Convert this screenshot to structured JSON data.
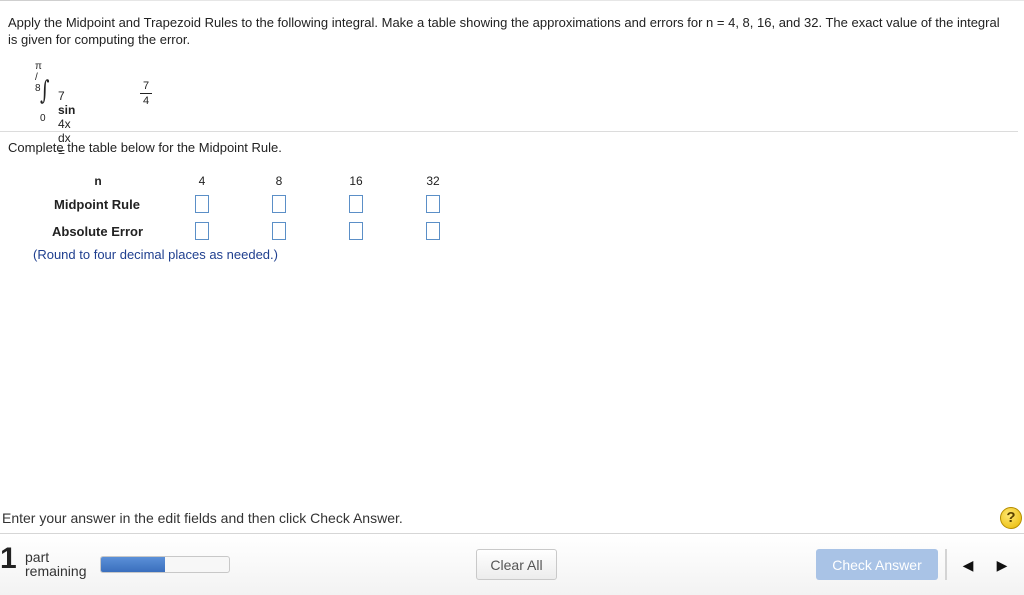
{
  "question": {
    "text": "Apply the Midpoint and Trapezoid Rules to the following integral. Make a table showing the approximations and errors for n = 4, 8, 16, and 32. The exact value of the integral is given for computing the error."
  },
  "integral": {
    "upper_limit": "π / 8",
    "lower_limit": "0",
    "integrand_prefix": "7 ",
    "integrand_sin": "sin",
    "integrand_suffix": " 4x dx =",
    "result_numerator": "7",
    "result_denominator": "4"
  },
  "instruction": "Complete the table below for the Midpoint Rule.",
  "table": {
    "header_label": "n",
    "columns": [
      "4",
      "8",
      "16",
      "32"
    ],
    "rows": [
      {
        "label": "Midpoint Rule",
        "values": [
          "",
          "",
          "",
          ""
        ]
      },
      {
        "label": "Absolute Error",
        "values": [
          "",
          "",
          "",
          ""
        ]
      }
    ],
    "note": "(Round to four decimal places as needed.)"
  },
  "help_text": "Enter your answer in the edit fields and then click Check Answer.",
  "help_icon": {
    "glyph": "?",
    "icon": "help-icon",
    "color": "#f2c200"
  },
  "footer": {
    "parts_count": "1",
    "parts_label_1": "part",
    "parts_label_2": "remaining",
    "progress": 0.5,
    "clear_all_label": "Clear All",
    "check_answer_label": "Check Answer",
    "prev_glyph": "◀",
    "next_glyph": "▶"
  },
  "colors": {
    "accent": "#3a6fbd",
    "check_button": "#a9c3e6",
    "note_text": "#1f3f8f",
    "input_border": "#5b8fc7"
  }
}
